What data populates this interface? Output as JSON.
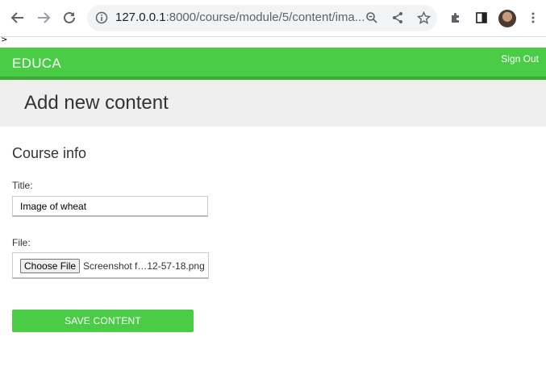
{
  "browser": {
    "url_host": "127.0.0.1",
    "url_rest": ":8000/course/module/5/content/ima..."
  },
  "stray_text": ">",
  "header": {
    "logo": "EDUCA",
    "sign_out": "Sign Out"
  },
  "page": {
    "title": "Add new content",
    "section_title": "Course info"
  },
  "form": {
    "title_label": "Title:",
    "title_value": "Image of wheat",
    "file_label": "File:",
    "choose_file_label": "Choose File",
    "file_name": "Screenshot f…12-57-18.png",
    "save_label": "SAVE CONTENT"
  },
  "colors": {
    "brand_green": "#4bcc46",
    "title_band": "#efefef"
  }
}
